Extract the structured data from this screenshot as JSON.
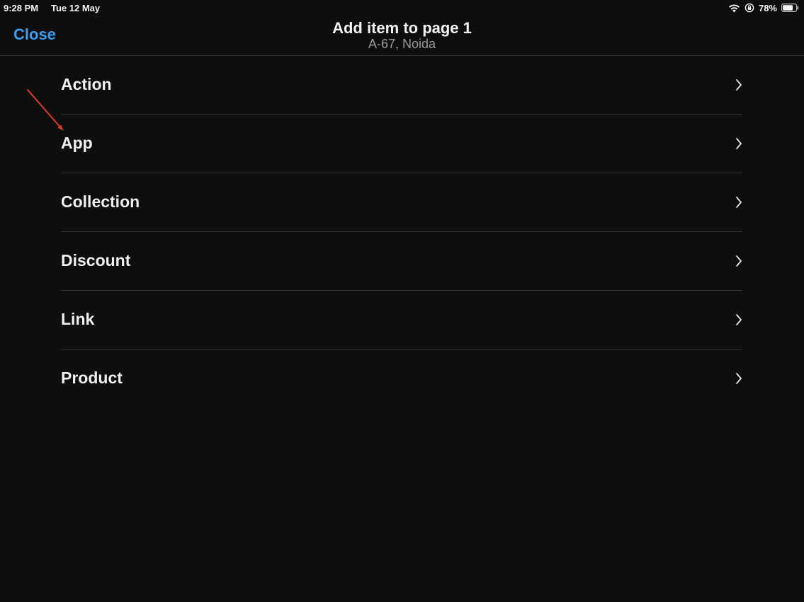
{
  "status_bar": {
    "time": "9:28 PM",
    "date": "Tue 12 May",
    "battery_percent": "78%",
    "battery_level": 0.78,
    "icons": [
      "wifi-icon",
      "orientation-lock-icon",
      "battery-icon"
    ]
  },
  "header": {
    "close_label": "Close",
    "title": "Add item to page 1",
    "subtitle": "A-67, Noida"
  },
  "items": [
    {
      "label": "Action"
    },
    {
      "label": "App"
    },
    {
      "label": "Collection"
    },
    {
      "label": "Discount"
    },
    {
      "label": "Link"
    },
    {
      "label": "Product"
    }
  ],
  "colors": {
    "background": "#0e0e0f",
    "accent": "#3a9df0",
    "annotation_arrow": "#e0392b"
  }
}
